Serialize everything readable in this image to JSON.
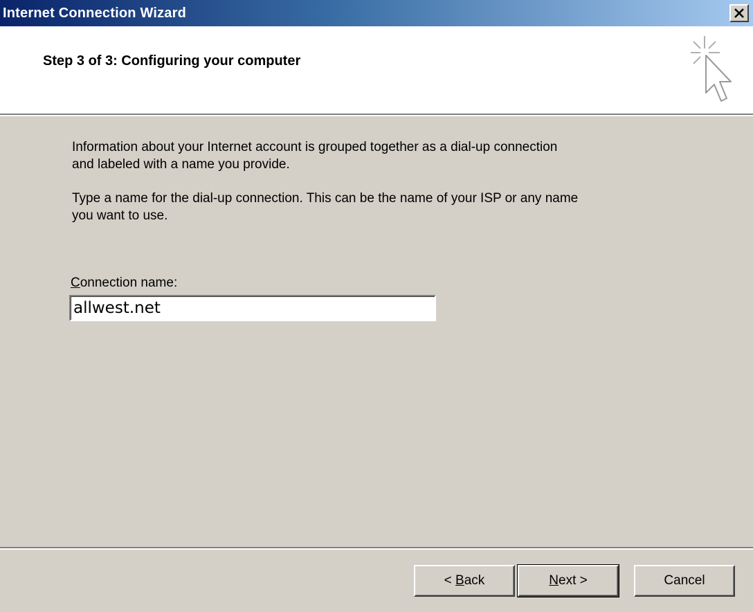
{
  "window": {
    "title": "Internet Connection Wizard",
    "close_glyph": "✕"
  },
  "header": {
    "title": "Step 3 of 3: Configuring your computer",
    "icon": "wizard-cursor-sparkle-icon"
  },
  "content": {
    "paragraph1_line1": "Information about your Internet account is grouped together as a dial-up connection",
    "paragraph1_line2": "and labeled with a name you provide.",
    "paragraph2_line1": "Type a name for the dial-up connection. This can be the name of your ISP or any name",
    "paragraph2_line2": "you want to use.",
    "connection_label_mnemonic": "C",
    "connection_label_rest": "onnection name:",
    "connection_name_value": "allwest.net"
  },
  "buttons": {
    "back_prefix": "< ",
    "back_mnemonic": "B",
    "back_rest": "ack",
    "next_mnemonic": "N",
    "next_rest": "ext >",
    "cancel": "Cancel"
  }
}
